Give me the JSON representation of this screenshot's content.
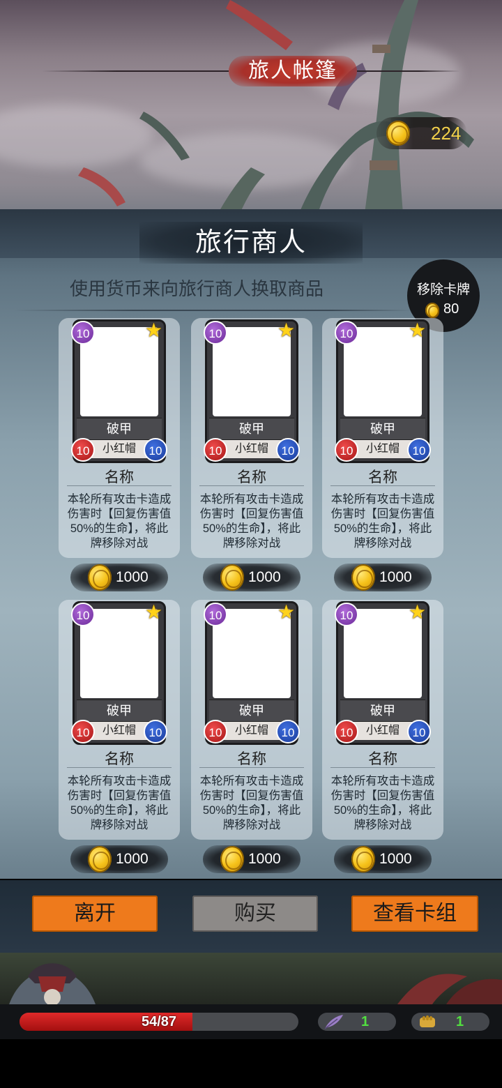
{
  "header": {
    "title": "旅人帐篷"
  },
  "currency": {
    "coins": "224",
    "icon": "gold-coin-icon",
    "accent": "#f2d04a"
  },
  "shop": {
    "title": "旅行商人",
    "subtitle": "使用货币来向旅行商人换取商品",
    "remove_card": {
      "label": "移除卡牌",
      "price": "80"
    }
  },
  "cards": [
    {
      "cost": "10",
      "type": "破甲",
      "owner": "小红帽",
      "attack": "10",
      "defense": "10",
      "name": "名称",
      "desc": "本轮所有攻击卡造成伤害时【回复伤害值50%的生命】，将此牌移除对战",
      "price": "1000"
    },
    {
      "cost": "10",
      "type": "破甲",
      "owner": "小红帽",
      "attack": "10",
      "defense": "10",
      "name": "名称",
      "desc": "本轮所有攻击卡造成伤害时【回复伤害值50%的生命】，将此牌移除对战",
      "price": "1000"
    },
    {
      "cost": "10",
      "type": "破甲",
      "owner": "小红帽",
      "attack": "10",
      "defense": "10",
      "name": "名称",
      "desc": "本轮所有攻击卡造成伤害时【回复伤害值50%的生命】，将此牌移除对战",
      "price": "1000"
    },
    {
      "cost": "10",
      "type": "破甲",
      "owner": "小红帽",
      "attack": "10",
      "defense": "10",
      "name": "名称",
      "desc": "本轮所有攻击卡造成伤害时【回复伤害值50%的生命】，将此牌移除对战",
      "price": "1000"
    },
    {
      "cost": "10",
      "type": "破甲",
      "owner": "小红帽",
      "attack": "10",
      "defense": "10",
      "name": "名称",
      "desc": "本轮所有攻击卡造成伤害时【回复伤害值50%的生命】，将此牌移除对战",
      "price": "1000"
    },
    {
      "cost": "10",
      "type": "破甲",
      "owner": "小红帽",
      "attack": "10",
      "defense": "10",
      "name": "名称",
      "desc": "本轮所有攻击卡造成伤害时【回复伤害值50%的生命】，将此牌移除对战",
      "price": "1000"
    }
  ],
  "actions": {
    "leave": "离开",
    "buy": "购买",
    "view_deck": "查看卡组"
  },
  "status": {
    "hp_text": "54/87",
    "hp_current": 54,
    "hp_max": 87,
    "hp_color": "#e02a2a",
    "feather_count": "1",
    "fist_count": "1",
    "stat_color": "#52e040"
  }
}
